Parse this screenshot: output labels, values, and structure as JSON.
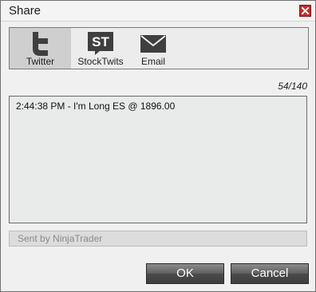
{
  "window": {
    "title": "Share"
  },
  "services": [
    {
      "label": "Twitter",
      "icon": "twitter-icon",
      "active": true
    },
    {
      "label": "StockTwits",
      "icon": "stocktwits-icon",
      "active": false
    },
    {
      "label": "Email",
      "icon": "email-icon",
      "active": false
    }
  ],
  "stocktwits_icon_text": "ST",
  "counter": "54/140",
  "message": {
    "text": "2:44:38 PM - I'm Long ES @ 1896.00"
  },
  "footer": {
    "signature": "Sent by NinjaTrader"
  },
  "buttons": {
    "ok": "OK",
    "cancel": "Cancel"
  },
  "colors": {
    "close_button": "#c62b2b",
    "active_service_bg": "#cfcfcf",
    "button_dark": "#4a4a4a"
  }
}
